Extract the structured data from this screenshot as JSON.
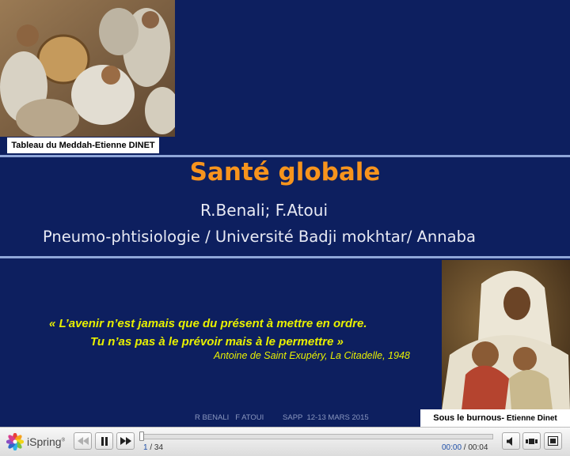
{
  "slide": {
    "title": "Santé globale",
    "authors": "R.Benali; F.Atoui",
    "affiliation": "Pneumo-phtisiologie / Université Badji mokhtar/  Annaba",
    "caption_top_left": "Tableau du Meddah-Etienne DINET",
    "caption_bottom_right_main": "Sous le burnous-",
    "caption_bottom_right_author": " Etienne Dinet",
    "quote_line1": "« L’avenir n’est jamais que du présent à mettre en ordre.",
    "quote_line2": "Tu n’as pas à le prévoir mais à le permettre »",
    "quote_attribution": "Antoine de Saint Exupéry, La Citadelle, 1948",
    "footer": "R BENALI   F ATOUI         SAPP  12-13 MARS 2015",
    "colors": {
      "background": "#0d1f5f",
      "title": "#f7941d",
      "quote": "#e8f000",
      "rule": "#8fa6d8"
    }
  },
  "player": {
    "brand": "iSpring",
    "brand_mark": "®",
    "current_slide": "1",
    "slide_separator": " / ",
    "total_slides": "34",
    "time_current": "00:00",
    "time_separator": " / ",
    "time_total": "00:04",
    "progress": 0,
    "icons": {
      "logo": "ispring-flower-icon",
      "rewind": "rewind-icon",
      "pause": "pause-icon",
      "forward": "forward-icon",
      "volume": "volume-icon",
      "outline": "outline-icon",
      "fullscreen": "fullscreen-icon"
    }
  }
}
